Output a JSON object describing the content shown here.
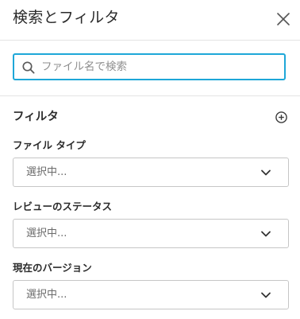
{
  "panel": {
    "title": "検索とフィルタ",
    "close_icon": "close-icon"
  },
  "search": {
    "placeholder": "ファイル名で検索",
    "value": "",
    "icon": "search-icon",
    "accent_color": "#1ea7d8"
  },
  "filters": {
    "title": "フィルタ",
    "add_icon": "plus-circle-icon",
    "fields": [
      {
        "label": "ファイル タイプ",
        "value": "選択中..."
      },
      {
        "label": "レビューのステータス",
        "value": "選択中..."
      },
      {
        "label": "現在のバージョン",
        "value": "選択中..."
      }
    ]
  }
}
